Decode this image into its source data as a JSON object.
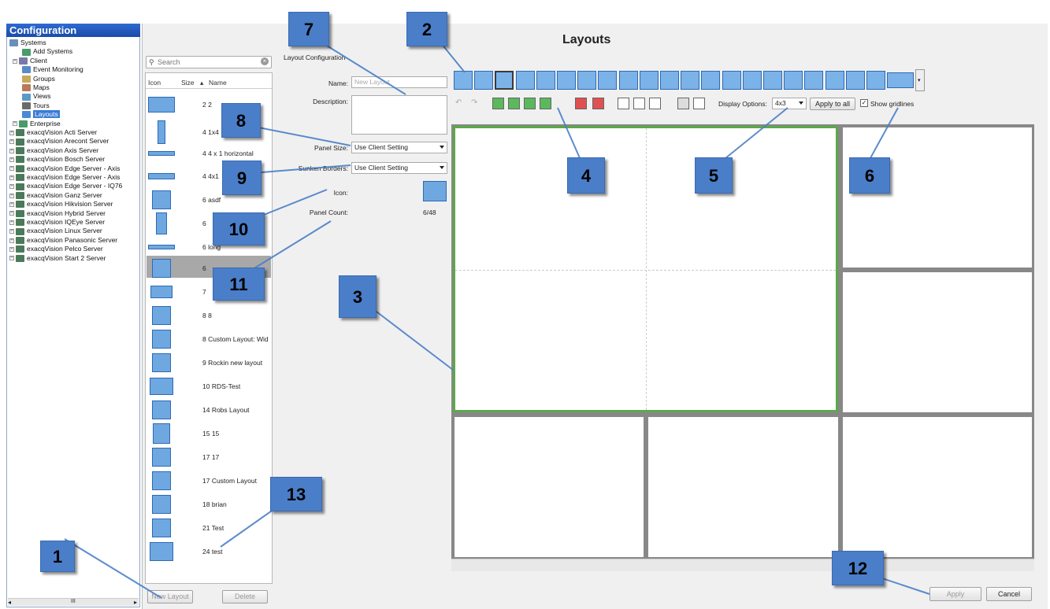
{
  "sidebar": {
    "title": "Configuration",
    "items": [
      {
        "label": "Systems"
      },
      {
        "label": "Add Systems"
      },
      {
        "label": "Client"
      },
      {
        "label": "Event Monitoring"
      },
      {
        "label": "Groups"
      },
      {
        "label": "Maps"
      },
      {
        "label": "Views"
      },
      {
        "label": "Tours"
      },
      {
        "label": "Layouts"
      },
      {
        "label": "Enterprise"
      },
      {
        "label": "exacqVision Acti Server"
      },
      {
        "label": "exacqVision Arecont Server"
      },
      {
        "label": "exacqVision Axis Server"
      },
      {
        "label": "exacqVision Bosch Server"
      },
      {
        "label": "exacqVision Edge Server - Axis"
      },
      {
        "label": "exacqVision Edge Server - Axis"
      },
      {
        "label": "exacqVision Edge Server - IQ76"
      },
      {
        "label": "exacqVision Ganz Server"
      },
      {
        "label": "exacqVision Hikvision Server"
      },
      {
        "label": "exacqVision Hybrid Server"
      },
      {
        "label": "exacqVision IQEye Server"
      },
      {
        "label": "exacqVision Linux Server"
      },
      {
        "label": "exacqVision Panasonic Server"
      },
      {
        "label": "exacqVision Pelco Server"
      },
      {
        "label": "exacqVision Start 2 Server"
      }
    ],
    "scroll_label": "III"
  },
  "list": {
    "search_placeholder": "Search",
    "col_icon": "Icon",
    "col_size": "Size",
    "col_name": "Name",
    "rows": [
      {
        "label": "2 2"
      },
      {
        "label": "4 1x4"
      },
      {
        "label": "4 4 x 1 horizontal"
      },
      {
        "label": "4 4x1"
      },
      {
        "label": "6 asdf"
      },
      {
        "label": "6"
      },
      {
        "label": "6 long"
      },
      {
        "label": "6"
      },
      {
        "label": "7"
      },
      {
        "label": "8 8"
      },
      {
        "label": "8 Custom Layout: Wid"
      },
      {
        "label": "9 Rockin new layout"
      },
      {
        "label": "10 RDS-Test"
      },
      {
        "label": "14 Robs Layout"
      },
      {
        "label": "15 15"
      },
      {
        "label": "17 17"
      },
      {
        "label": "17 Custom Layout"
      },
      {
        "label": "18 brian"
      },
      {
        "label": "21 Test"
      },
      {
        "label": "24 test"
      }
    ],
    "new_layout": "New Layout",
    "delete": "Delete"
  },
  "config": {
    "heading": "Layout Configuration",
    "name_label": "Name:",
    "name_placeholder": "New Layout",
    "description_label": "Description:",
    "panel_size_label": "Panel Size:",
    "panel_size_value": "Use Client Setting",
    "sunken_label": "Sunken Borders:",
    "sunken_value": "Use Client Setting",
    "icon_label": "Icon:",
    "panel_count_label": "Panel Count:",
    "panel_count_value": "6/48"
  },
  "main": {
    "title": "Layouts",
    "display_options_label": "Display Options:",
    "display_options_value": "4x3",
    "apply_all": "Apply to all",
    "show_gridlines": "Show gridlines",
    "apply": "Apply",
    "cancel": "Cancel"
  },
  "callouts": [
    "1",
    "2",
    "3",
    "4",
    "5",
    "6",
    "7",
    "8",
    "9",
    "10",
    "11",
    "12",
    "13"
  ],
  "colors": {
    "accent": "#4a7ec8",
    "selection": "#3a7bd5",
    "selected_cell_border": "#5ca84a"
  }
}
